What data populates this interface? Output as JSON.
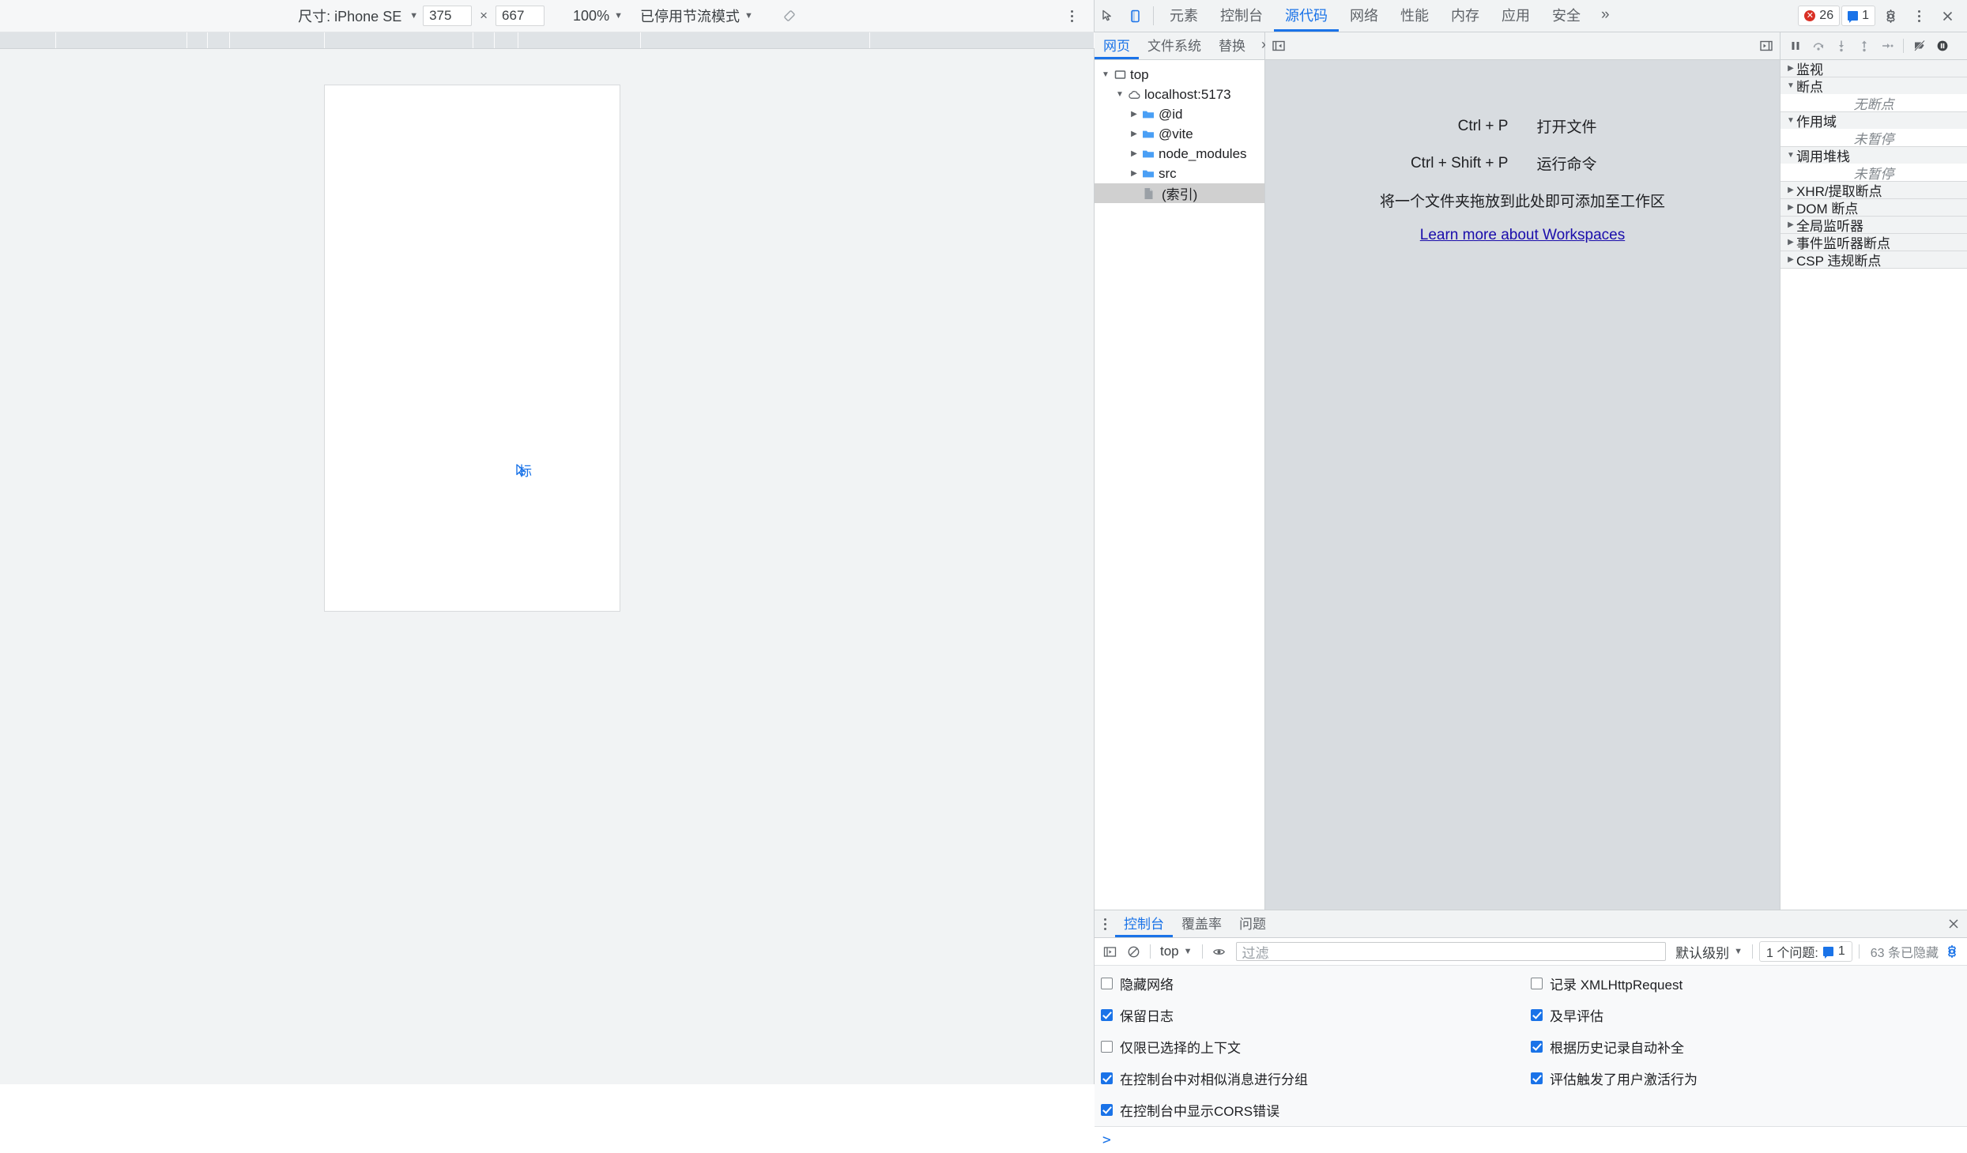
{
  "device_toolbar": {
    "size_label": "尺寸: iPhone SE",
    "width": "375",
    "separator": "×",
    "height": "667",
    "zoom": "100%",
    "throttling": "已停用节流模式",
    "rotate_icon": "rotate-device-icon",
    "more_icon": "more-options-icon"
  },
  "page": {
    "text": "标",
    "cursor_icon": "mouse-cursor-icon"
  },
  "devtools": {
    "inspect_icon": "inspect-element-icon",
    "device_toggle_icon": "toggle-device-toolbar-icon",
    "tabs": [
      {
        "label": "元素",
        "active": false
      },
      {
        "label": "控制台",
        "active": false
      },
      {
        "label": "源代码",
        "active": true
      },
      {
        "label": "网络",
        "active": false
      },
      {
        "label": "性能",
        "active": false
      },
      {
        "label": "内存",
        "active": false
      },
      {
        "label": "应用",
        "active": false
      },
      {
        "label": "安全",
        "active": false
      }
    ],
    "more_tabs": "»",
    "error_badge": {
      "icon": "error-icon",
      "count": "26"
    },
    "warning_badge": {
      "icon": "message-icon",
      "count": "1"
    },
    "settings_icon": "gear-icon",
    "more_icon": "more-options-icon",
    "close_icon": "close-icon"
  },
  "navigator": {
    "tabs": [
      {
        "label": "网页",
        "active": true
      },
      {
        "label": "文件系统",
        "active": false
      },
      {
        "label": "替换",
        "active": false
      }
    ],
    "more_tabs": "»",
    "more_icon": "more-options-icon",
    "tree": [
      {
        "label": "top",
        "depth": 0,
        "twisty": "▼",
        "icon": "frame-icon",
        "selected": false
      },
      {
        "label": "localhost:5173",
        "depth": 1,
        "twisty": "▼",
        "icon": "cloud-icon",
        "selected": false
      },
      {
        "label": "@id",
        "depth": 2,
        "twisty": "▶",
        "icon": "folder-icon",
        "selected": false
      },
      {
        "label": "@vite",
        "depth": 2,
        "twisty": "▶",
        "icon": "folder-icon",
        "selected": false
      },
      {
        "label": "node_modules",
        "depth": 2,
        "twisty": "▶",
        "icon": "folder-icon",
        "selected": false
      },
      {
        "label": "src",
        "depth": 2,
        "twisty": "▶",
        "icon": "folder-icon",
        "selected": false
      },
      {
        "label": "(索引)",
        "depth": 3,
        "twisty": "",
        "icon": "document-icon",
        "selected": true
      }
    ]
  },
  "editor": {
    "collapse_left_icon": "collapse-sidebar-left-icon",
    "collapse_right_icon": "collapse-sidebar-right-icon",
    "shortcuts": [
      {
        "key": "Ctrl + P",
        "desc": "打开文件"
      },
      {
        "key": "Ctrl + Shift + P",
        "desc": "运行命令"
      }
    ],
    "drop_note": "将一个文件夹拖放到此处即可添加至工作区",
    "learn_more": "Learn more about Workspaces"
  },
  "debugger": {
    "toolbar": [
      {
        "icon": "pause-script-icon"
      },
      {
        "icon": "step-over-icon"
      },
      {
        "icon": "step-into-icon"
      },
      {
        "icon": "step-out-icon"
      },
      {
        "icon": "step-icon"
      },
      {
        "icon": "deactivate-breakpoints-icon"
      },
      {
        "icon": "pause-on-exceptions-icon"
      }
    ],
    "sections": [
      {
        "title": "监视",
        "twisty": "▶",
        "expanded": false,
        "empty_text": ""
      },
      {
        "title": "断点",
        "twisty": "▼",
        "expanded": true,
        "empty_text": "无断点"
      },
      {
        "title": "作用域",
        "twisty": "▼",
        "expanded": true,
        "empty_text": "未暂停"
      },
      {
        "title": "调用堆栈",
        "twisty": "▼",
        "expanded": true,
        "empty_text": "未暂停"
      },
      {
        "title": "XHR/提取断点",
        "twisty": "▶",
        "expanded": false,
        "empty_text": ""
      },
      {
        "title": "DOM 断点",
        "twisty": "▶",
        "expanded": false,
        "empty_text": ""
      },
      {
        "title": "全局监听器",
        "twisty": "▶",
        "expanded": false,
        "empty_text": ""
      },
      {
        "title": "事件监听器断点",
        "twisty": "▶",
        "expanded": false,
        "empty_text": ""
      },
      {
        "title": "CSP 违规断点",
        "twisty": "▶",
        "expanded": false,
        "empty_text": ""
      }
    ]
  },
  "drawer": {
    "more_icon": "more-options-icon",
    "tabs": [
      {
        "label": "控制台",
        "active": true
      },
      {
        "label": "覆盖率",
        "active": false
      },
      {
        "label": "问题",
        "active": false
      }
    ],
    "close_icon": "close-icon",
    "console_toolbar": {
      "sidebar_icon": "console-sidebar-icon",
      "clear_icon": "clear-console-icon",
      "context": "top",
      "eye_icon": "live-expression-icon",
      "filter_placeholder": "过滤",
      "level": "默认级别",
      "issues_label": "1 个问题:",
      "issues_count": "1",
      "issues_icon": "message-icon",
      "hidden_count": "63 条已隐藏",
      "settings_icon": "gear-icon"
    },
    "settings_left": [
      {
        "label": "隐藏网络",
        "checked": false
      },
      {
        "label": "保留日志",
        "checked": true
      },
      {
        "label": "仅限已选择的上下文",
        "checked": false
      },
      {
        "label": "在控制台中对相似消息进行分组",
        "checked": true
      },
      {
        "label": "在控制台中显示CORS错误",
        "checked": true
      }
    ],
    "settings_right": [
      {
        "label": "记录 XMLHttpRequest",
        "checked": false
      },
      {
        "label": "及早评估",
        "checked": true
      },
      {
        "label": "根据历史记录自动补全",
        "checked": true
      },
      {
        "label": "评估触发了用户激活行为",
        "checked": true
      }
    ],
    "prompt": ">"
  },
  "colors": {
    "accent": "#1a73e8",
    "error": "#d93025",
    "toolbar_bg": "#f1f3f4",
    "ruler_bg": "#dfe3e6",
    "editor_bg": "#d8dce0",
    "link": "#1a0dab"
  }
}
